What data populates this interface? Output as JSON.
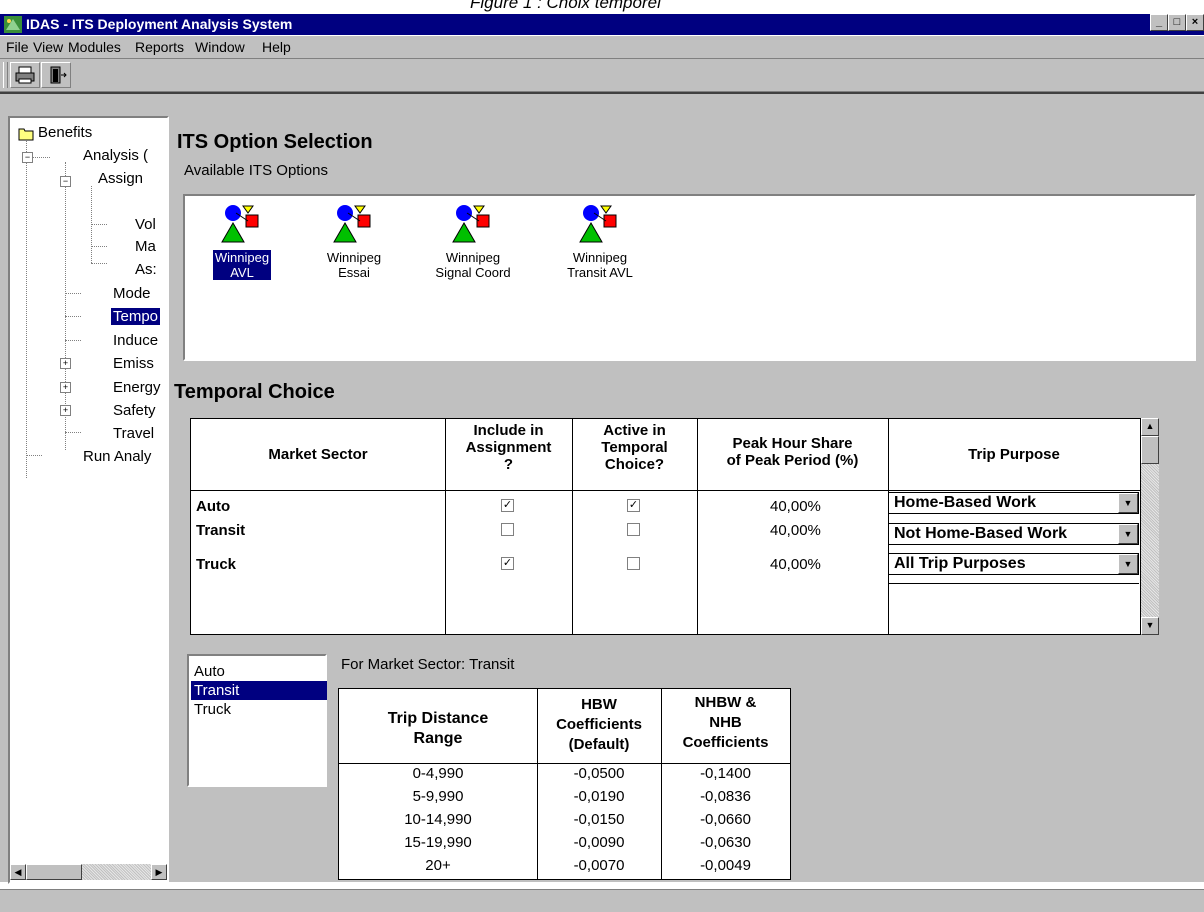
{
  "caption": "Figure 1 : Choix temporel",
  "window": {
    "title": "IDAS - ITS Deployment Analysis System"
  },
  "menu": [
    "File",
    "View",
    "Modules",
    "Reports",
    "Window",
    "Help"
  ],
  "tree": {
    "items": [
      "Benefits",
      "Analysis (",
      "Assign",
      "Vol",
      "Ma",
      "As:",
      "Mode",
      "Tempo",
      "Induce",
      "Emiss",
      "Energy",
      "Safety",
      "Travel",
      "Run Analy"
    ]
  },
  "its_options": {
    "heading": "ITS Option Selection",
    "sublabel": "Available ITS Options",
    "options": [
      {
        "line1": "Winnipeg",
        "line2": "AVL"
      },
      {
        "line1": "Winnipeg",
        "line2": "Essai"
      },
      {
        "line1": "Winnipeg",
        "line2": "Signal Coord"
      },
      {
        "line1": "Winnipeg",
        "line2": "Transit AVL"
      }
    ]
  },
  "temporal": {
    "heading": "Temporal Choice",
    "columns": {
      "market_sector": "Market Sector",
      "include_l1": "Include in",
      "include_l2": "Assignment",
      "include_l3": "?",
      "active_l1": "Active in",
      "active_l2": "Temporal",
      "active_l3": "Choice?",
      "peak_l1": "Peak Hour Share",
      "peak_l2": "of Peak Period (%)",
      "purpose": "Trip Purpose"
    },
    "rows": [
      {
        "sector": "Auto",
        "include": true,
        "active": true,
        "peak": "40,00%",
        "purpose": "Home-Based Work"
      },
      {
        "sector": "Transit",
        "include": false,
        "active": false,
        "peak": "40,00%",
        "purpose": "Not Home-Based Work"
      },
      {
        "sector": "Truck",
        "include": true,
        "active": false,
        "peak": "40,00%",
        "purpose": "All Trip Purposes"
      }
    ]
  },
  "sector_list": {
    "items": [
      "Auto",
      "Transit",
      "Truck"
    ],
    "selected_index": 1
  },
  "coef": {
    "label": "For Market Sector: Transit",
    "columns": {
      "range_l1": "Trip  Distance",
      "range_l2": "Range",
      "hbw_l1": "HBW",
      "hbw_l2": "Coefficients",
      "hbw_l3": "(Default)",
      "nhbw_l1": "NHBW &",
      "nhbw_l2": "NHB",
      "nhbw_l3": "Coefficients"
    },
    "rows": [
      {
        "range": "0-4,990",
        "hbw": "-0,0500",
        "nhbw": "-0,1400"
      },
      {
        "range": "5-9,990",
        "hbw": "-0,0190",
        "nhbw": "-0,0836"
      },
      {
        "range": "10-14,990",
        "hbw": "-0,0150",
        "nhbw": "-0,0660"
      },
      {
        "range": "15-19,990",
        "hbw": "-0,0090",
        "nhbw": "-0,0630"
      },
      {
        "range": "20+",
        "hbw": "-0,0070",
        "nhbw": "-0,0049"
      }
    ]
  },
  "colors": {
    "titlebar": "#000080",
    "selection": "#000080",
    "face": "#c0c0c0"
  },
  "icons": {
    "print": "printer-icon",
    "exit": "exit-door-icon",
    "folder": "folder-icon",
    "option": "its-option-icon"
  }
}
